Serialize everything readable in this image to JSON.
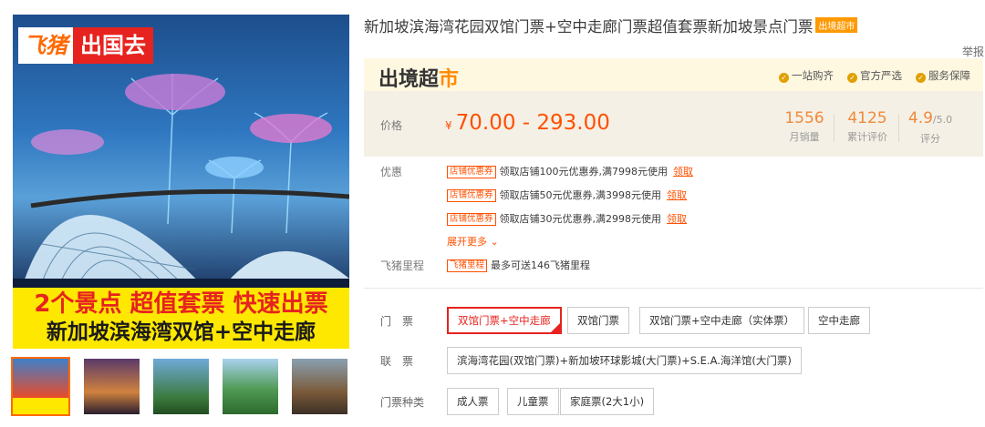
{
  "gallery": {
    "brand_a": "飞猪",
    "brand_b": "出国去",
    "banner_line1": "2个景点 超值套票 快速出票",
    "banner_line2": "新加坡滨海湾双馆+空中走廊"
  },
  "product": {
    "title": "新加坡滨海湾花园双馆门票+空中走廊门票超值套票新加坡景点门票",
    "title_tag": "出境超市",
    "report": "举报"
  },
  "market": {
    "logo_a": "出境超",
    "logo_b": "市",
    "guarantees": [
      "一站购齐",
      "官方严选",
      "服务保障"
    ]
  },
  "pricing": {
    "label": "价格",
    "currency": "¥",
    "range": "70.00 - 293.00",
    "stats": [
      {
        "value": "1556",
        "suffix": "",
        "label": "月销量"
      },
      {
        "value": "4125",
        "suffix": "",
        "label": "累计评价"
      },
      {
        "value": "4.9",
        "suffix": "/5.0",
        "label": "评分"
      }
    ]
  },
  "promotions": {
    "label": "优惠",
    "tag": "店铺优惠券",
    "items": [
      {
        "text": "领取店铺100元优惠券,满7998元使用",
        "action": "领取"
      },
      {
        "text": "领取店铺50元优惠券,满3998元使用",
        "action": "领取"
      },
      {
        "text": "领取店铺30元优惠券,满2998元使用",
        "action": "领取"
      }
    ],
    "expand": "展开更多 ⌄"
  },
  "mileage": {
    "label": "飞猪里程",
    "tag": "飞猪里程",
    "text": "最多可送146飞猪里程"
  },
  "options": {
    "ticket": {
      "label": "门　票",
      "chips": [
        "双馆门票+空中走廊",
        "双馆门票",
        "双馆门票+空中走廊（实体票）",
        "空中走廊"
      ],
      "selected": 0
    },
    "combo": {
      "label": "联　票",
      "chips": [
        "滨海湾花园(双馆门票)+新加坡环球影城(大门票)+S.E.A.海洋馆(大门票)"
      ]
    },
    "type": {
      "label": "门票种类",
      "chips": [
        "成人票",
        "儿童票",
        "家庭票(2大1小)"
      ]
    }
  },
  "colors": {
    "accent": "#ff5000",
    "brand_red": "#e6231e",
    "banner_yellow": "#ffe800"
  }
}
